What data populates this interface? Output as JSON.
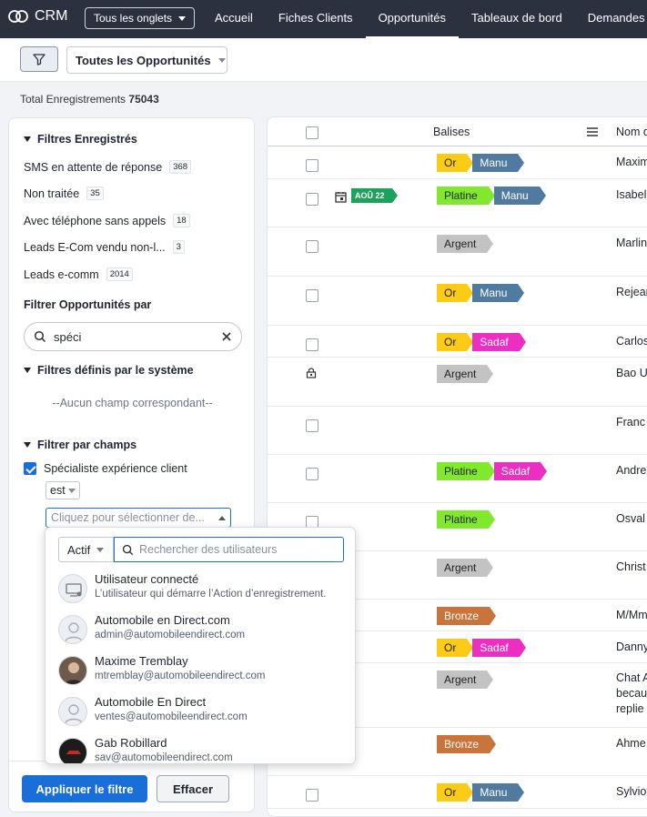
{
  "topbar": {
    "app_name": "CRM",
    "all_tabs": "Tous les onglets",
    "nav": [
      "Accueil",
      "Fiches Clients",
      "Opportunités",
      "Tableaux de bord",
      "Demandes"
    ]
  },
  "toolbar": {
    "view": "Toutes les Opportunités"
  },
  "total": {
    "label": "Total Enregistrements",
    "value": "75043"
  },
  "left": {
    "saved_title": "Filtres Enregistrés",
    "saved": [
      {
        "label": "SMS en attente de réponse",
        "count": "368"
      },
      {
        "label": "Non traitée",
        "count": "35"
      },
      {
        "label": "Avec téléphone sans appels",
        "count": "18"
      },
      {
        "label": "Leads E-Com vendu non-l...",
        "count": "3"
      },
      {
        "label": "Leads e-comm",
        "count": "2014"
      }
    ],
    "filter_by": "Filtrer Opportunités par",
    "search_value": "spéci",
    "system_title": "Filtres définis par le système",
    "no_match": "--Aucun champ correspondant--",
    "fields_title": "Filtrer par champs",
    "field_label": "Spécialiste expérience client",
    "operator": "est",
    "picker_placeholder": "Cliquez pour sélectionner de...",
    "apply": "Appliquer le filtre",
    "clear": "Effacer"
  },
  "dropdown": {
    "status": "Actif",
    "search_placeholder": "Rechercher des utilisateurs",
    "users": [
      {
        "name": "Utilisateur connecté",
        "sub": "L’utilisateur qui démarre l’Action d’enregistrement."
      },
      {
        "name": "Automobile en Direct.com",
        "sub": "admin@automobileendirect.com"
      },
      {
        "name": "Maxime Tremblay",
        "sub": "mtremblay@automobileendirect.com"
      },
      {
        "name": "Automobile En Direct",
        "sub": "ventes@automobileendirect.com"
      },
      {
        "name": "Gab Robillard",
        "sub": "sav@automobileendirect.com"
      }
    ]
  },
  "table": {
    "headers": {
      "tags": "Balises",
      "name": "Nom d"
    },
    "date_badge": "AOÛ 22",
    "rows": [
      {
        "tags": [
          {
            "t": "Or",
            "c": "#fbcb16"
          },
          {
            "t": "Manu",
            "c": "#507aa0"
          }
        ],
        "name": "Maxim"
      },
      {
        "tags": [
          {
            "t": "Platine",
            "c": "#80e92d"
          },
          {
            "t": "Manu",
            "c": "#507aa0"
          }
        ],
        "name": "Isabel"
      },
      {
        "tags": [
          {
            "t": "Argent",
            "c": "#c3c3c3"
          }
        ],
        "name": "Marlin"
      },
      {
        "tags": [
          {
            "t": "Or",
            "c": "#fbcb16"
          },
          {
            "t": "Manu",
            "c": "#507aa0"
          }
        ],
        "name": "Rejean"
      },
      {
        "tags": [
          {
            "t": "Or",
            "c": "#fbcb16"
          },
          {
            "t": "Sadaf",
            "c": "#ea2fc2"
          }
        ],
        "name": "Carlos"
      },
      {
        "tags": [
          {
            "t": "Argent",
            "c": "#c3c3c3"
          }
        ],
        "name": "Bao U"
      },
      {
        "tags": [],
        "name": "Franc"
      },
      {
        "tags": [
          {
            "t": "Platine",
            "c": "#80e92d"
          },
          {
            "t": "Sadaf",
            "c": "#ea2fc2"
          }
        ],
        "name": "Andre"
      },
      {
        "tags": [
          {
            "t": "Platine",
            "c": "#80e92d"
          }
        ],
        "name": "Osval"
      },
      {
        "tags": [
          {
            "t": "Argent",
            "c": "#c3c3c3"
          }
        ],
        "name": "Christ"
      },
      {
        "tags": [
          {
            "t": "Bronze",
            "c": "#c8743a"
          }
        ],
        "name": "M/Mm"
      },
      {
        "tags": [
          {
            "t": "Or",
            "c": "#fbcb16"
          },
          {
            "t": "Sadaf",
            "c": "#ea2fc2"
          }
        ],
        "name": "Danny"
      },
      {
        "tags": [
          {
            "t": "Argent",
            "c": "#c3c3c3"
          }
        ],
        "name": "Chat A\nbecau\nreplie"
      },
      {
        "tags": [
          {
            "t": "Bronze",
            "c": "#c8743a"
          }
        ],
        "name": "Ahme"
      },
      {
        "tags": [
          {
            "t": "Or",
            "c": "#fbcb16"
          },
          {
            "t": "Manu",
            "c": "#507aa0"
          }
        ],
        "name": "Sylvio"
      }
    ]
  }
}
